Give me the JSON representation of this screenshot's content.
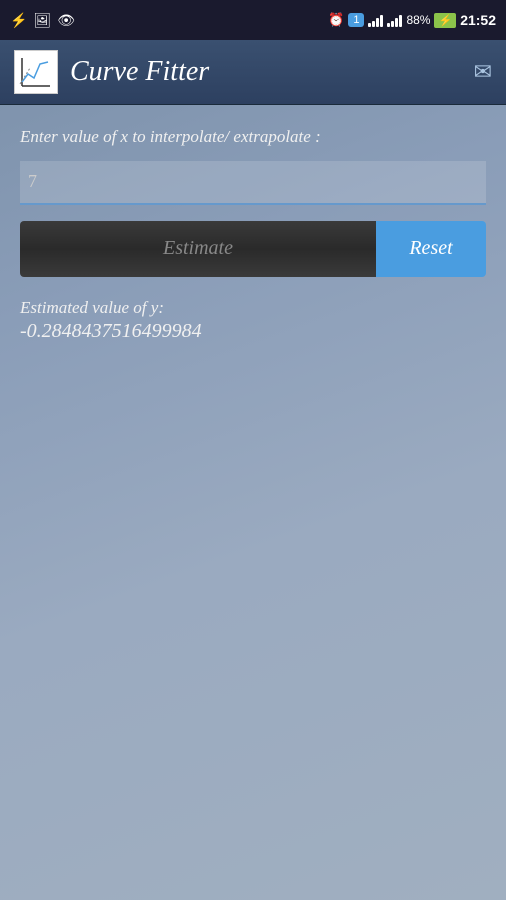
{
  "status_bar": {
    "time": "21:52",
    "battery_percent": "88%",
    "icons": [
      "usb",
      "image",
      "eye",
      "alarm",
      "notification",
      "signal",
      "battery",
      "charging"
    ]
  },
  "header": {
    "app_title": "Curve Fitter",
    "email_icon": "✉"
  },
  "main": {
    "input_label": "Enter value of x to interpolate/ extrapolate :",
    "input_value": "7",
    "input_placeholder": "7",
    "estimate_button_label": "Estimate",
    "reset_button_label": "Reset",
    "result_label": "Estimated value of  y:",
    "result_value": "-0.2848437516499984"
  }
}
